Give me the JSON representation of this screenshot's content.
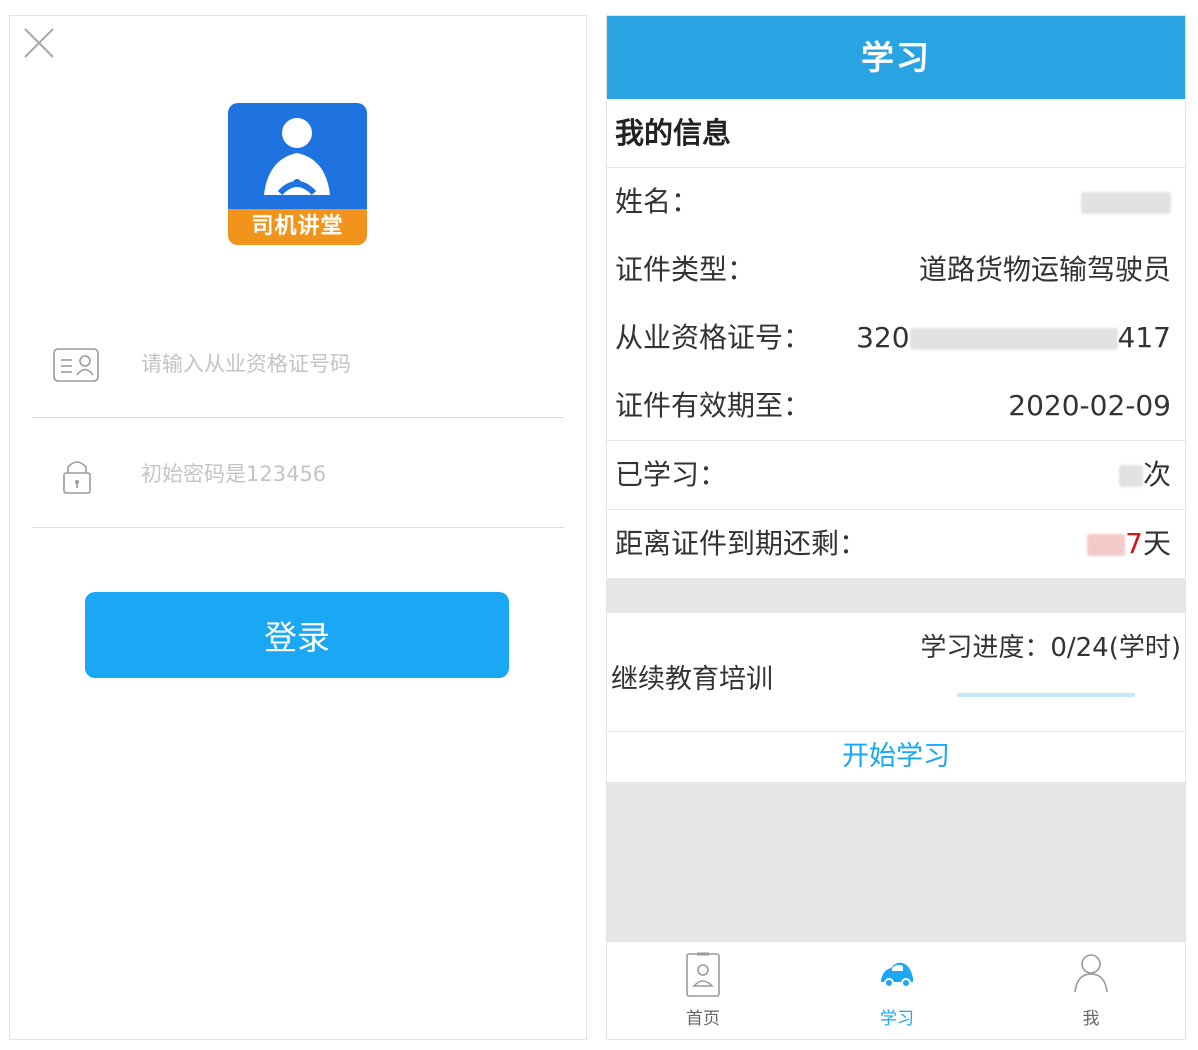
{
  "login": {
    "logo_text": "司机讲堂",
    "cert_placeholder": "请输入从业资格证号码",
    "password_placeholder": "初始密码是123456",
    "login_label": "登录"
  },
  "study": {
    "header_title": "学习",
    "info_title": "我的信息",
    "rows": {
      "name": {
        "label": "姓名：",
        "value": ""
      },
      "cert_type": {
        "label": "证件类型：",
        "value": "道路货物运输驾驶员"
      },
      "cert_no": {
        "label": "从业资格证号：",
        "prefix": "320",
        "suffix": "417"
      },
      "expiry": {
        "label": "证件有效期至：",
        "value": "2020-02-09"
      },
      "studied": {
        "label": "已学习：",
        "suffix": "次"
      },
      "remaining": {
        "label": "距离证件到期还剩：",
        "digit": "7",
        "unit": "天"
      }
    },
    "training": {
      "label": "继续教育培训",
      "progress_text": "学习进度：0/24(学时)",
      "progress_fraction": 0
    },
    "start_label": "开始学习",
    "tabs": [
      {
        "label": "首页",
        "icon": "id-card-icon"
      },
      {
        "label": "学习",
        "icon": "car-icon"
      },
      {
        "label": "我",
        "icon": "person-icon"
      }
    ],
    "colors": {
      "accent": "#2aa3e3",
      "button": "#1aa8f4",
      "logo_blue": "#1f73e0",
      "logo_orange": "#f2931c",
      "highlight_red": "#d8161b"
    }
  }
}
